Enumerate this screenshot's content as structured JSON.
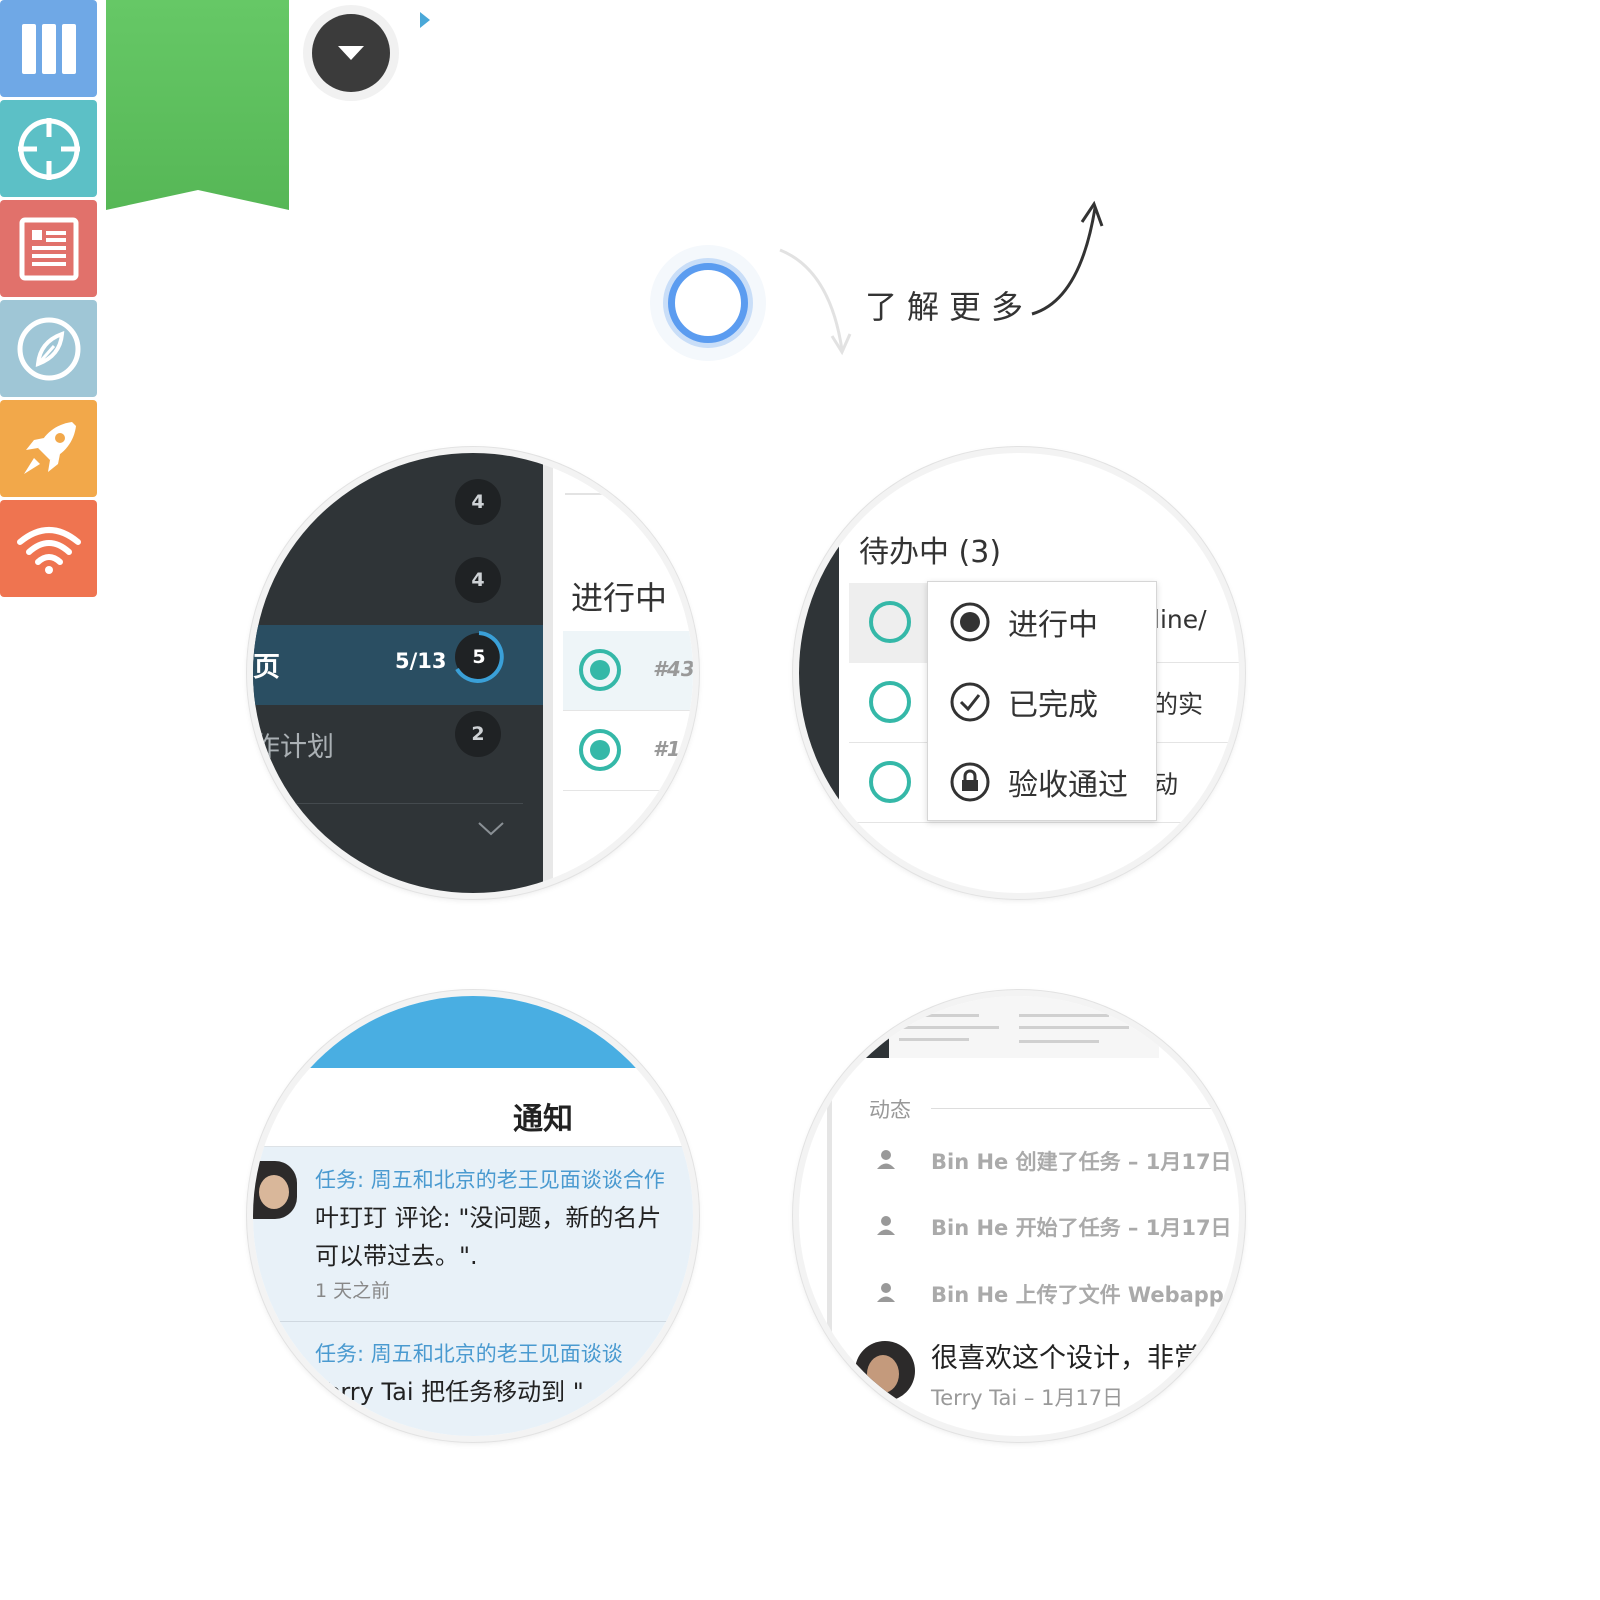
{
  "rail": {
    "items": [
      {
        "name": "columns",
        "color": "#6fa8e6"
      },
      {
        "name": "target",
        "color": "#5cc0c6"
      },
      {
        "name": "document",
        "color": "#e1716b"
      },
      {
        "name": "compass",
        "color": "#9fc6d6"
      },
      {
        "name": "rocket",
        "color": "#f2a84a"
      },
      {
        "name": "wifi",
        "color": "#ef7450"
      }
    ]
  },
  "ribbon": {
    "color": "#5cbf5c"
  },
  "hero": {
    "learn_more": "了解更多"
  },
  "lens_sidebar": {
    "counts": [
      "4",
      "4"
    ],
    "active_item": {
      "label": "页",
      "ratio": "5/13",
      "count": "5"
    },
    "plan_item": {
      "label": "作计划",
      "count": "2"
    },
    "column_title": "进行中",
    "task_id": "#43",
    "task_id_2": "#1"
  },
  "lens_status_menu": {
    "header": "待办中 (3)",
    "row_tails": [
      "line/",
      "的实",
      "动"
    ],
    "menu": [
      {
        "icon": "radio-dot-icon",
        "label": "进行中"
      },
      {
        "icon": "check-circle-icon",
        "label": "已完成"
      },
      {
        "icon": "lock-circle-icon",
        "label": "验收通过"
      }
    ]
  },
  "lens_notifications": {
    "title": "通知",
    "items": [
      {
        "task": "任务: 周五和北京的老王见面谈谈合作",
        "line1": "叶玎玎 评论: \"没问题，新的名片",
        "line2": "可以带过去。\".",
        "time": "1 天之前"
      },
      {
        "task": "任务: 周五和北京的老王见面谈谈",
        "line1": "Terry Tai 把任务移动到 \""
      }
    ]
  },
  "lens_activity": {
    "section": "动态",
    "items": [
      "Bin He 创建了任务 – 1月17日",
      "Bin He 开始了任务 – 1月17日",
      "Bin He 上传了文件 Webapp"
    ],
    "comment": "很喜欢这个设计，非常",
    "comment_meta": "Terry Tai – 1月17日"
  }
}
